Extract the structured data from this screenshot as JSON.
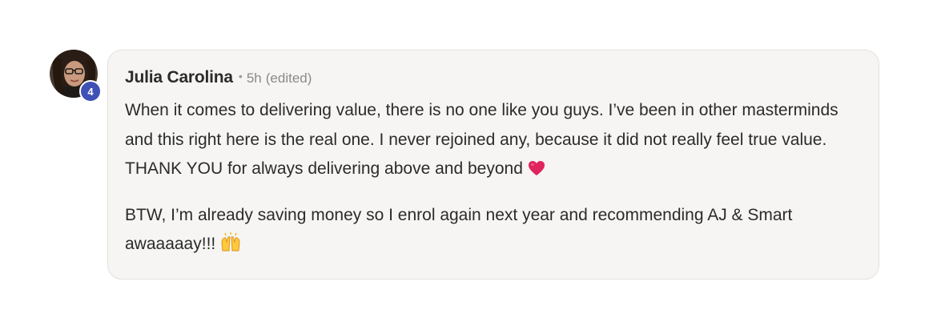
{
  "comment": {
    "author": "Julia Carolina",
    "level": "4",
    "separator": "•",
    "time": "5h",
    "edited": "(edited)",
    "paragraphs": [
      "When it comes to delivering value, there is no one like you guys. I’ve been in other masterminds and this right here is the real one. I never rejoined any, because it did not really feel true value. THANK YOU for always delivering above and beyond",
      "BTW, I’m already saving money so I enrol again next year and recommending AJ & Smart awaaaaay!!!"
    ],
    "emojis": [
      "heart-emoji",
      "raising-hands-emoji"
    ],
    "colors": {
      "bubble": "#f6f5f3",
      "bubble_border": "#e3e1de",
      "badge": "#3f51b5",
      "text": "#2b2b2b",
      "meta": "#8a8a8a",
      "heart": "#e0245e"
    }
  }
}
